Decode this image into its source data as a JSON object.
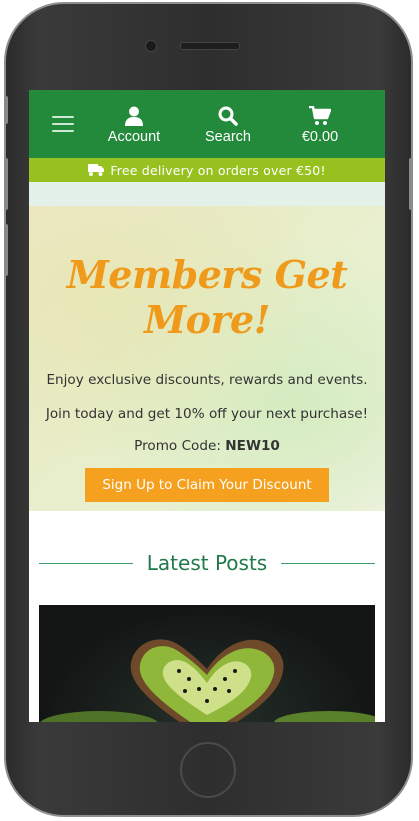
{
  "nav": {
    "menu_icon": "hamburger-icon",
    "account_label": "Account",
    "account_icon": "user-icon",
    "search_label": "Search",
    "search_icon": "search-icon",
    "cart_total": "€0.00",
    "cart_icon": "cart-icon"
  },
  "banner": {
    "icon": "truck-icon",
    "text": "Free delivery on orders over €50!"
  },
  "hero": {
    "title": "Members Get More!",
    "line1": "Enjoy exclusive discounts, rewards and events.",
    "line2": "Join today and get 10% off your next purchase!",
    "promo_label": "Promo Code: ",
    "promo_code": "NEW10",
    "cta_label": "Sign Up to Claim Your Discount"
  },
  "posts": {
    "heading": "Latest Posts"
  },
  "colors": {
    "nav_green": "#238a3b",
    "banner_green": "#97c11f",
    "accent_orange": "#f6a020",
    "heading_green": "#1f7a4a"
  }
}
